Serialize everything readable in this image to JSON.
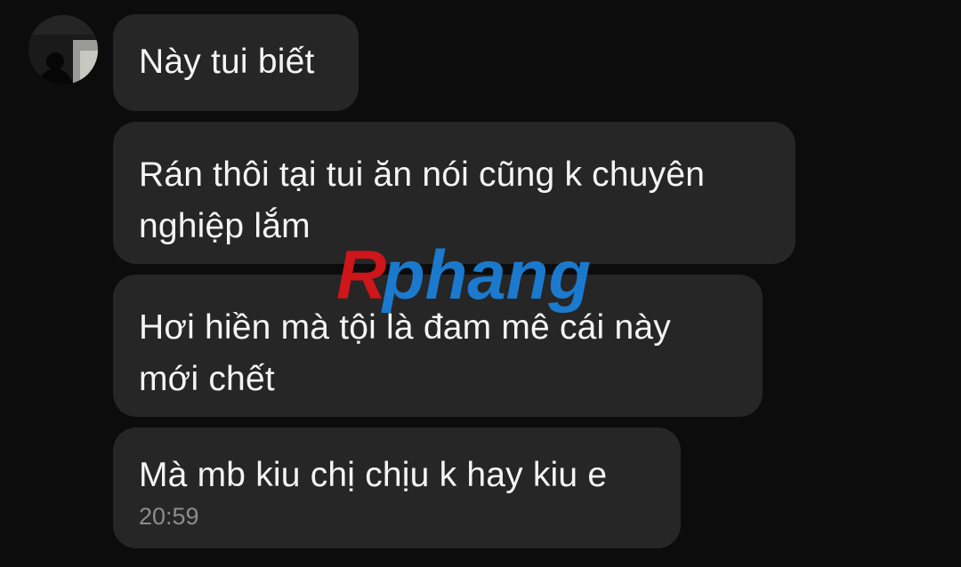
{
  "conversation": {
    "contact": {
      "avatar_icon": "profile-photo-silhouette-icon"
    },
    "messages": [
      {
        "lines": [
          "Này tui biết"
        ]
      },
      {
        "lines": [
          "Rán thôi tại tui ăn nói cũng k chuyên",
          "nghiệp lắm"
        ]
      },
      {
        "lines": [
          "Hơi hiền mà tội là đam mê cái này",
          "mới chết"
        ]
      },
      {
        "lines": [
          "Mà mb kiu chị chịu k hay kiu e"
        ],
        "time": "20:59"
      }
    ]
  },
  "watermark": {
    "first_letter": "R",
    "rest": "phang",
    "first_color": "#d8161b",
    "rest_color": "#1b7fd6"
  },
  "colors": {
    "background": "#0c0c0c",
    "bubble": "#262626",
    "text": "#f4f4f4",
    "timestamp": "#8c8c8c"
  }
}
